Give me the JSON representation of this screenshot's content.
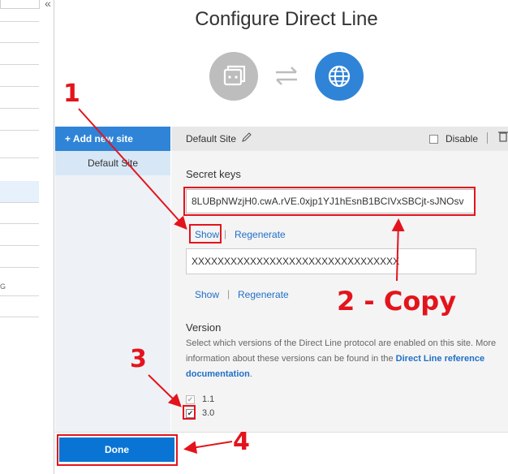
{
  "title": "Configure Direct Line",
  "left_strip": {
    "collapse_glyph": "«",
    "item_text": "G"
  },
  "channel_icons": {
    "bot": "bot-icon",
    "swap": "swap-arrows-icon",
    "globe": "globe-icon"
  },
  "sites": {
    "add_label": "+ Add new site",
    "items": [
      "Default Site"
    ]
  },
  "site_header": {
    "name": "Default Site",
    "edit_icon": "pencil-icon",
    "disable_label": "Disable",
    "delete_icon": "trash-icon"
  },
  "secret_keys": {
    "label": "Secret keys",
    "key1": {
      "value": "8LUBpNWzjH0.cwA.rVE.0xjp1YJ1hEsnB1BCIVxSBCjt-sJNOsv",
      "show_label": "Show",
      "separator": "|",
      "regenerate_label": "Regenerate"
    },
    "key2": {
      "value": "XXXXXXXXXXXXXXXXXXXXXXXXXXXXXXXX",
      "show_label": "Show",
      "separator": "|",
      "regenerate_label": "Regenerate"
    }
  },
  "version": {
    "label": "Version",
    "description_pre": "Select which versions of the Direct Line protocol are enabled on this site. More information about these versions can be found in the ",
    "description_link": "Direct Line reference documentation",
    "description_post": ".",
    "options": [
      {
        "label": "1.1",
        "checked": true,
        "disabled": true
      },
      {
        "label": "3.0",
        "checked": true,
        "disabled": false
      }
    ],
    "check_glyph": "✔"
  },
  "footer": {
    "done_label": "Done"
  },
  "annotations": {
    "labels": [
      "1",
      "2 - Copy",
      "3",
      "4"
    ],
    "color": "#e3141c"
  },
  "colors": {
    "accent": "#2f84d7",
    "done_button": "#0a74d4",
    "link": "#1f6fc7"
  }
}
